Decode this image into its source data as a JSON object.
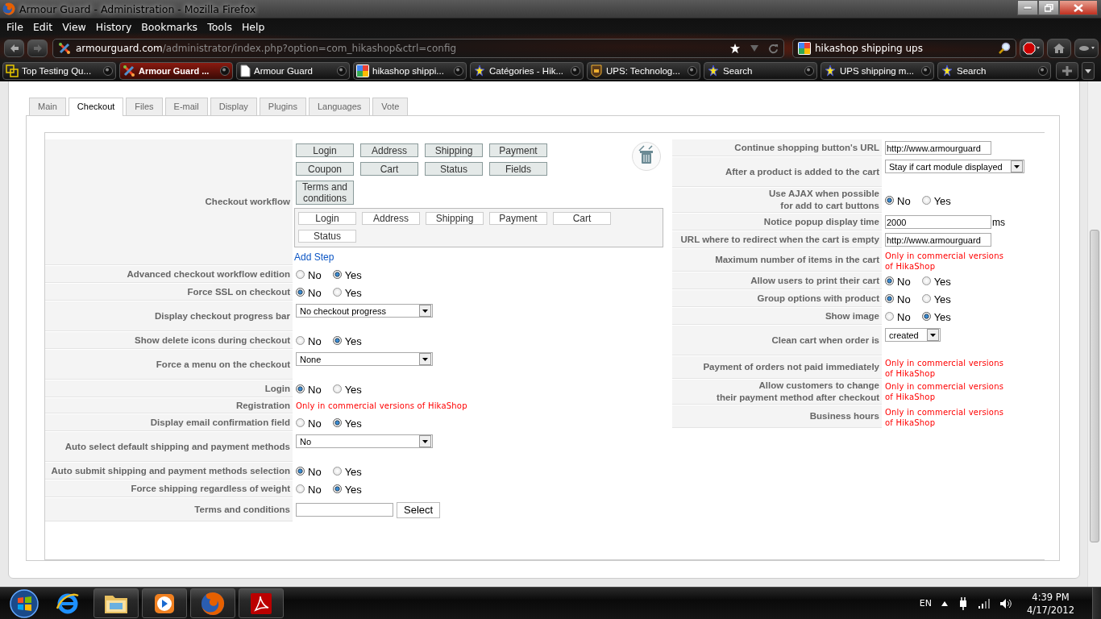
{
  "window": {
    "title": "Armour Guard - Administration - Mozilla Firefox"
  },
  "menu": [
    "File",
    "Edit",
    "View",
    "History",
    "Bookmarks",
    "Tools",
    "Help"
  ],
  "address_bar": {
    "host": "armourguard.com",
    "path": "/administrator/index.php?option=com_hikashop&ctrl=config"
  },
  "search_field": {
    "value": "hikashop shipping ups"
  },
  "browser_tabs": [
    {
      "label": "Top Testing Qu...",
      "selected": false
    },
    {
      "label": "Armour Guard ...",
      "selected": true
    },
    {
      "label": "Armour Guard",
      "selected": false
    },
    {
      "label": "hikashop shippi...",
      "selected": false
    },
    {
      "label": "Catégories - Hik...",
      "selected": false
    },
    {
      "label": "UPS: Technolog...",
      "selected": false
    },
    {
      "label": "Search",
      "selected": false
    },
    {
      "label": "UPS shipping m...",
      "selected": false
    },
    {
      "label": "Search",
      "selected": false
    }
  ],
  "config_tabs": [
    {
      "label": "Main",
      "selected": false
    },
    {
      "label": "Checkout",
      "selected": true
    },
    {
      "label": "Files",
      "selected": false
    },
    {
      "label": "E-mail",
      "selected": false
    },
    {
      "label": "Display",
      "selected": false
    },
    {
      "label": "Plugins",
      "selected": false
    },
    {
      "label": "Languages",
      "selected": false
    },
    {
      "label": "Vote",
      "selected": false
    }
  ],
  "checkout_left": {
    "rows": [
      {
        "label": "Checkout workflow",
        "kind": "workflow",
        "available_steps": [
          "Login",
          "Address",
          "Shipping",
          "Payment",
          "Coupon",
          "Cart",
          "Status",
          "Fields",
          "Terms and conditions"
        ],
        "chosen_steps": [
          "Login",
          "Address",
          "Shipping",
          "Payment",
          "Cart",
          "Status"
        ],
        "link": "Add Step"
      },
      {
        "label": "Advanced checkout workflow edition",
        "kind": "radio",
        "options": [
          {
            "label": "No",
            "selected": false
          },
          {
            "label": "Yes",
            "selected": true
          }
        ]
      },
      {
        "label": "Force SSL on checkout",
        "kind": "radio",
        "options": [
          {
            "label": "No",
            "selected": true
          },
          {
            "label": "Yes",
            "selected": false
          }
        ]
      },
      {
        "label": "Display checkout progress bar",
        "kind": "select",
        "value": "No checkout progress"
      },
      {
        "label": "Show delete icons during checkout",
        "kind": "radio",
        "options": [
          {
            "label": "No",
            "selected": false
          },
          {
            "label": "Yes",
            "selected": true
          }
        ]
      },
      {
        "label": "Force a menu on the checkout",
        "kind": "select",
        "value": "None"
      },
      {
        "label": "Login",
        "kind": "radio",
        "options": [
          {
            "label": "No",
            "selected": true
          },
          {
            "label": "Yes",
            "selected": false
          }
        ]
      },
      {
        "label": "Registration",
        "kind": "notice",
        "text": "Only in commercial versions of HikaShop"
      },
      {
        "label": "Display email confirmation field",
        "kind": "radio",
        "options": [
          {
            "label": "No",
            "selected": false
          },
          {
            "label": "Yes",
            "selected": true
          }
        ]
      },
      {
        "label": "Auto select default shipping and payment methods",
        "kind": "select",
        "value": "No"
      },
      {
        "label": "Auto submit shipping and payment methods selection",
        "kind": "radio",
        "options": [
          {
            "label": "No",
            "selected": true
          },
          {
            "label": "Yes",
            "selected": false
          }
        ]
      },
      {
        "label": "Force shipping regardless of weight",
        "kind": "radio",
        "options": [
          {
            "label": "No",
            "selected": false
          },
          {
            "label": "Yes",
            "selected": true
          }
        ]
      },
      {
        "label": "Terms and conditions",
        "kind": "picker",
        "button": "Select"
      }
    ]
  },
  "checkout_right": {
    "rows": [
      {
        "label": "Continue shopping button's URL",
        "kind": "text",
        "value": "http://www.armourguard"
      },
      {
        "label": "After a product is added to the cart",
        "kind": "select",
        "value": "Stay if cart module displayed"
      },
      {
        "label": "Use AJAX when possible\nfor add to cart buttons",
        "kind": "radio",
        "options": [
          {
            "label": "No",
            "selected": true
          },
          {
            "label": "Yes",
            "selected": false
          }
        ]
      },
      {
        "label": "Notice popup display time",
        "kind": "text",
        "value": "2000",
        "unit": "ms"
      },
      {
        "label": "URL where to redirect when the cart is empty",
        "kind": "text",
        "value": "http://www.armourguard"
      },
      {
        "label": "Maximum number of items in the cart",
        "kind": "notice",
        "text": "Only in commercial versions of HikaShop"
      },
      {
        "label": "Allow users to print their cart",
        "kind": "radio",
        "options": [
          {
            "label": "No",
            "selected": true
          },
          {
            "label": "Yes",
            "selected": false
          }
        ]
      },
      {
        "label": "Group options with product",
        "kind": "radio",
        "options": [
          {
            "label": "No",
            "selected": true
          },
          {
            "label": "Yes",
            "selected": false
          }
        ]
      },
      {
        "label": "Show image",
        "kind": "radio",
        "options": [
          {
            "label": "No",
            "selected": false
          },
          {
            "label": "Yes",
            "selected": true
          }
        ]
      },
      {
        "label": "Clean cart when order is",
        "kind": "select",
        "value": "created"
      },
      {
        "label": "Payment of orders not paid immediately",
        "kind": "notice",
        "text": "Only in commercial versions of HikaShop"
      },
      {
        "label": "Allow customers to change\ntheir payment method after checkout",
        "kind": "notice",
        "text": "Only in commercial versions of HikaShop"
      },
      {
        "label": "Business hours",
        "kind": "notice",
        "text": "Only in commercial versions of HikaShop"
      }
    ]
  },
  "taskbar": {
    "language": "EN",
    "time": "4:39 PM",
    "date": "4/17/2012"
  }
}
